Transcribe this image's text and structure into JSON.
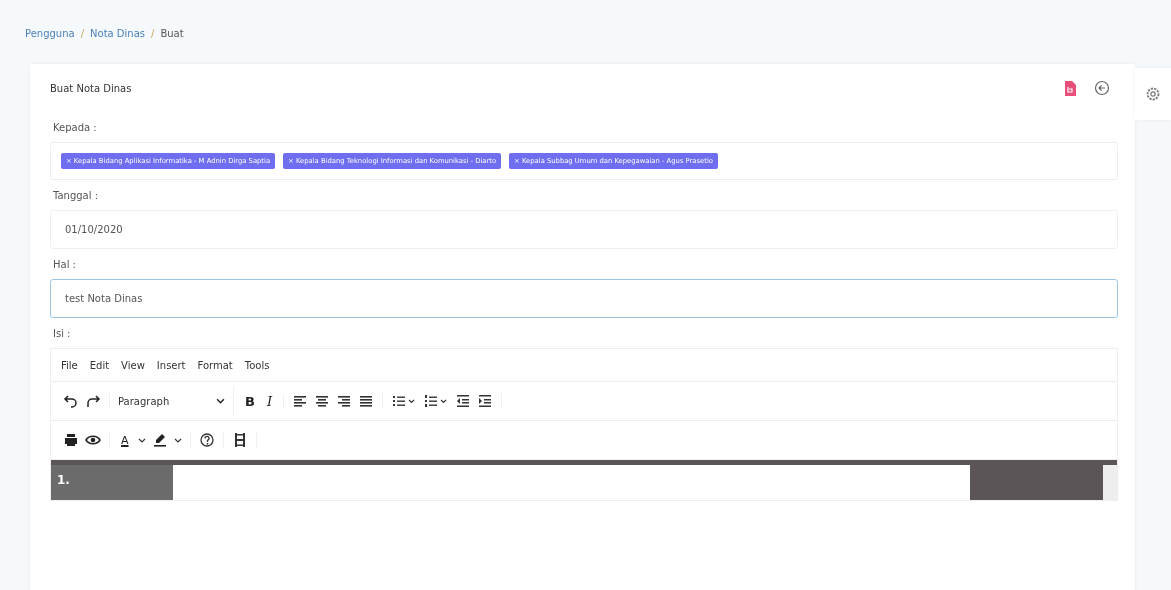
{
  "breadcrumb": [
    {
      "label": "Pengguna",
      "kind": "link"
    },
    {
      "label": "/",
      "kind": "separator"
    },
    {
      "label": "Nota Dinas",
      "kind": "link"
    },
    {
      "label": "/",
      "kind": "separator"
    },
    {
      "label": "Buat",
      "kind": "current"
    }
  ],
  "card": {
    "title": "Buat Nota Dinas"
  },
  "fields": [
    {
      "kind": "tags",
      "label": "Kepada :",
      "tags": [
        "× Kepala Bidang Aplikasi Informatika - M Adnin Dirga Saptia",
        "× Kepala Bidang Teknologi Informasi dan Komunikasi - Diarto",
        "× Kepala Subbag Umum dan Kepegawaian - Agus Prasetio"
      ]
    },
    {
      "kind": "input",
      "label": "Tanggal :",
      "value": "01/10/2020",
      "focused": false
    },
    {
      "kind": "input",
      "label": "Hal :",
      "value": "test Nota Dinas",
      "focused": true
    },
    {
      "kind": "editor",
      "label": "Isi :"
    }
  ],
  "editor": {
    "menu": [
      "File",
      "Edit",
      "View",
      "Insert",
      "Format",
      "Tools"
    ],
    "block_format": "Paragraph",
    "bold": "B",
    "italic": "I",
    "text_color": "A",
    "line_number": "1."
  }
}
